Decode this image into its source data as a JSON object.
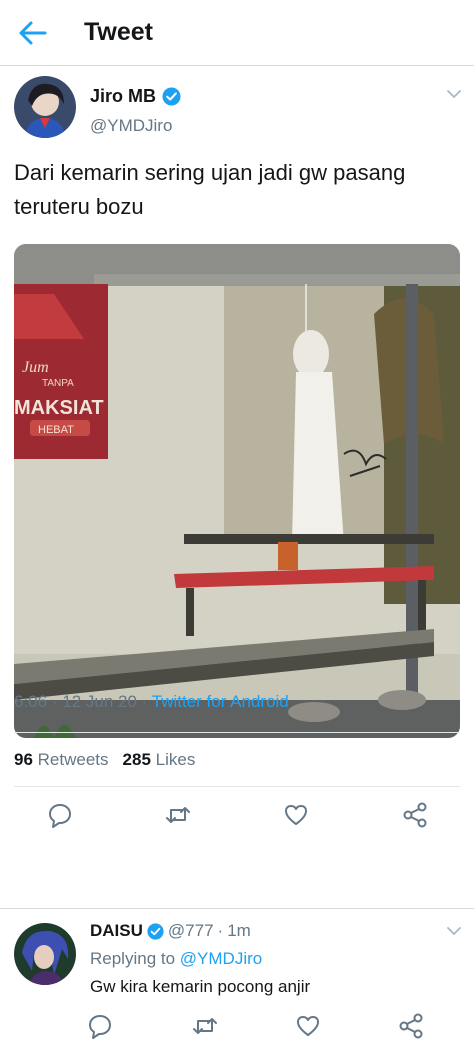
{
  "header": {
    "title": "Tweet"
  },
  "tweet": {
    "display_name": "Jiro MB",
    "handle": "@YMDJiro",
    "text": "Dari kemarin sering ujan jadi gw pasang teruteru bozu",
    "time": "6:06",
    "dot": "·",
    "date": "12 Jun 20",
    "source": "Twitter for Android",
    "retweets_count": "96",
    "retweets_label": "Retweets",
    "likes_count": "285",
    "likes_label": "Likes",
    "photo_sign": {
      "line1": "Jum",
      "line2": "TANPA",
      "line3": "MAKSIAT",
      "line4": "HEBAT"
    }
  },
  "reply": {
    "display_name": "DAISU",
    "handle": "@777",
    "dot": "·",
    "age": "1m",
    "replying_label": "Replying to",
    "replying_to": "@YMDJiro",
    "text": "Gw kira kemarin pocong anjir"
  },
  "colors": {
    "accent": "#1da1f2",
    "muted": "#657786",
    "text": "#14171a"
  },
  "icons": [
    "back-arrow-icon",
    "verified-icon",
    "chevron-down-icon",
    "reply-icon",
    "retweet-icon",
    "like-icon",
    "share-icon"
  ]
}
